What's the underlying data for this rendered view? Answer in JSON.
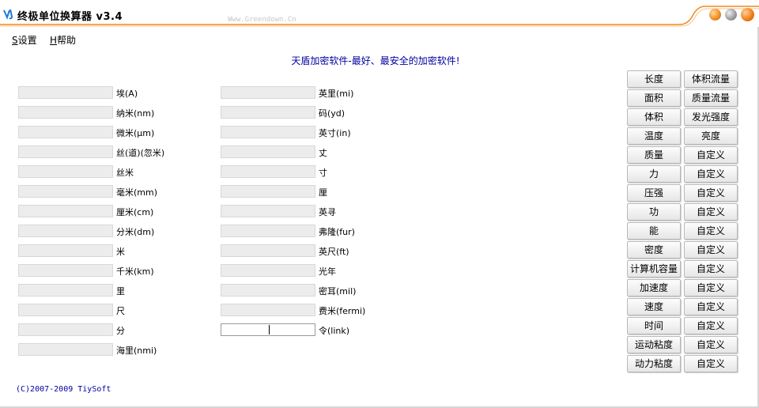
{
  "window": {
    "title": "终极单位换算器 v3.4",
    "watermark": "Www.Greendown.Cn"
  },
  "menu": {
    "settings_key": "S",
    "settings_label": "设置",
    "help_key": "H",
    "help_label": "帮助"
  },
  "banner": "天盾加密软件-最好、最安全的加密软件!",
  "units_left": [
    {
      "label": "埃(A)",
      "value": ""
    },
    {
      "label": "纳米(nm)",
      "value": ""
    },
    {
      "label": "微米(μm)",
      "value": ""
    },
    {
      "label": "丝(道)(忽米)",
      "value": ""
    },
    {
      "label": "丝米",
      "value": ""
    },
    {
      "label": "毫米(mm)",
      "value": ""
    },
    {
      "label": "厘米(cm)",
      "value": ""
    },
    {
      "label": "分米(dm)",
      "value": ""
    },
    {
      "label": "米",
      "value": ""
    },
    {
      "label": "千米(km)",
      "value": ""
    },
    {
      "label": "里",
      "value": ""
    },
    {
      "label": "尺",
      "value": ""
    },
    {
      "label": "分",
      "value": ""
    },
    {
      "label": "海里(nmi)",
      "value": ""
    }
  ],
  "units_right": [
    {
      "label": "英里(mi)",
      "value": ""
    },
    {
      "label": "码(yd)",
      "value": ""
    },
    {
      "label": "英寸(in)",
      "value": ""
    },
    {
      "label": "丈",
      "value": ""
    },
    {
      "label": "寸",
      "value": ""
    },
    {
      "label": "厘",
      "value": ""
    },
    {
      "label": "英寻",
      "value": ""
    },
    {
      "label": "弗隆(fur)",
      "value": ""
    },
    {
      "label": "英尺(ft)",
      "value": ""
    },
    {
      "label": "光年",
      "value": ""
    },
    {
      "label": "密耳(mil)",
      "value": ""
    },
    {
      "label": "费米(fermi)",
      "value": ""
    },
    {
      "label": "令(link)",
      "value": ""
    }
  ],
  "categories_left": [
    "长度",
    "面积",
    "体积",
    "温度",
    "质量",
    "力",
    "压强",
    "功",
    "能",
    "密度",
    "计算机容量",
    "加速度",
    "速度",
    "时间",
    "运动粘度",
    "动力粘度"
  ],
  "categories_right": [
    "体积流量",
    "质量流量",
    "发光强度",
    "亮度",
    "自定义",
    "自定义",
    "自定义",
    "自定义",
    "自定义",
    "自定义",
    "自定义",
    "自定义",
    "自定义",
    "自定义",
    "自定义",
    "自定义"
  ],
  "copyright": "(C)2007-2009 TiySoft"
}
